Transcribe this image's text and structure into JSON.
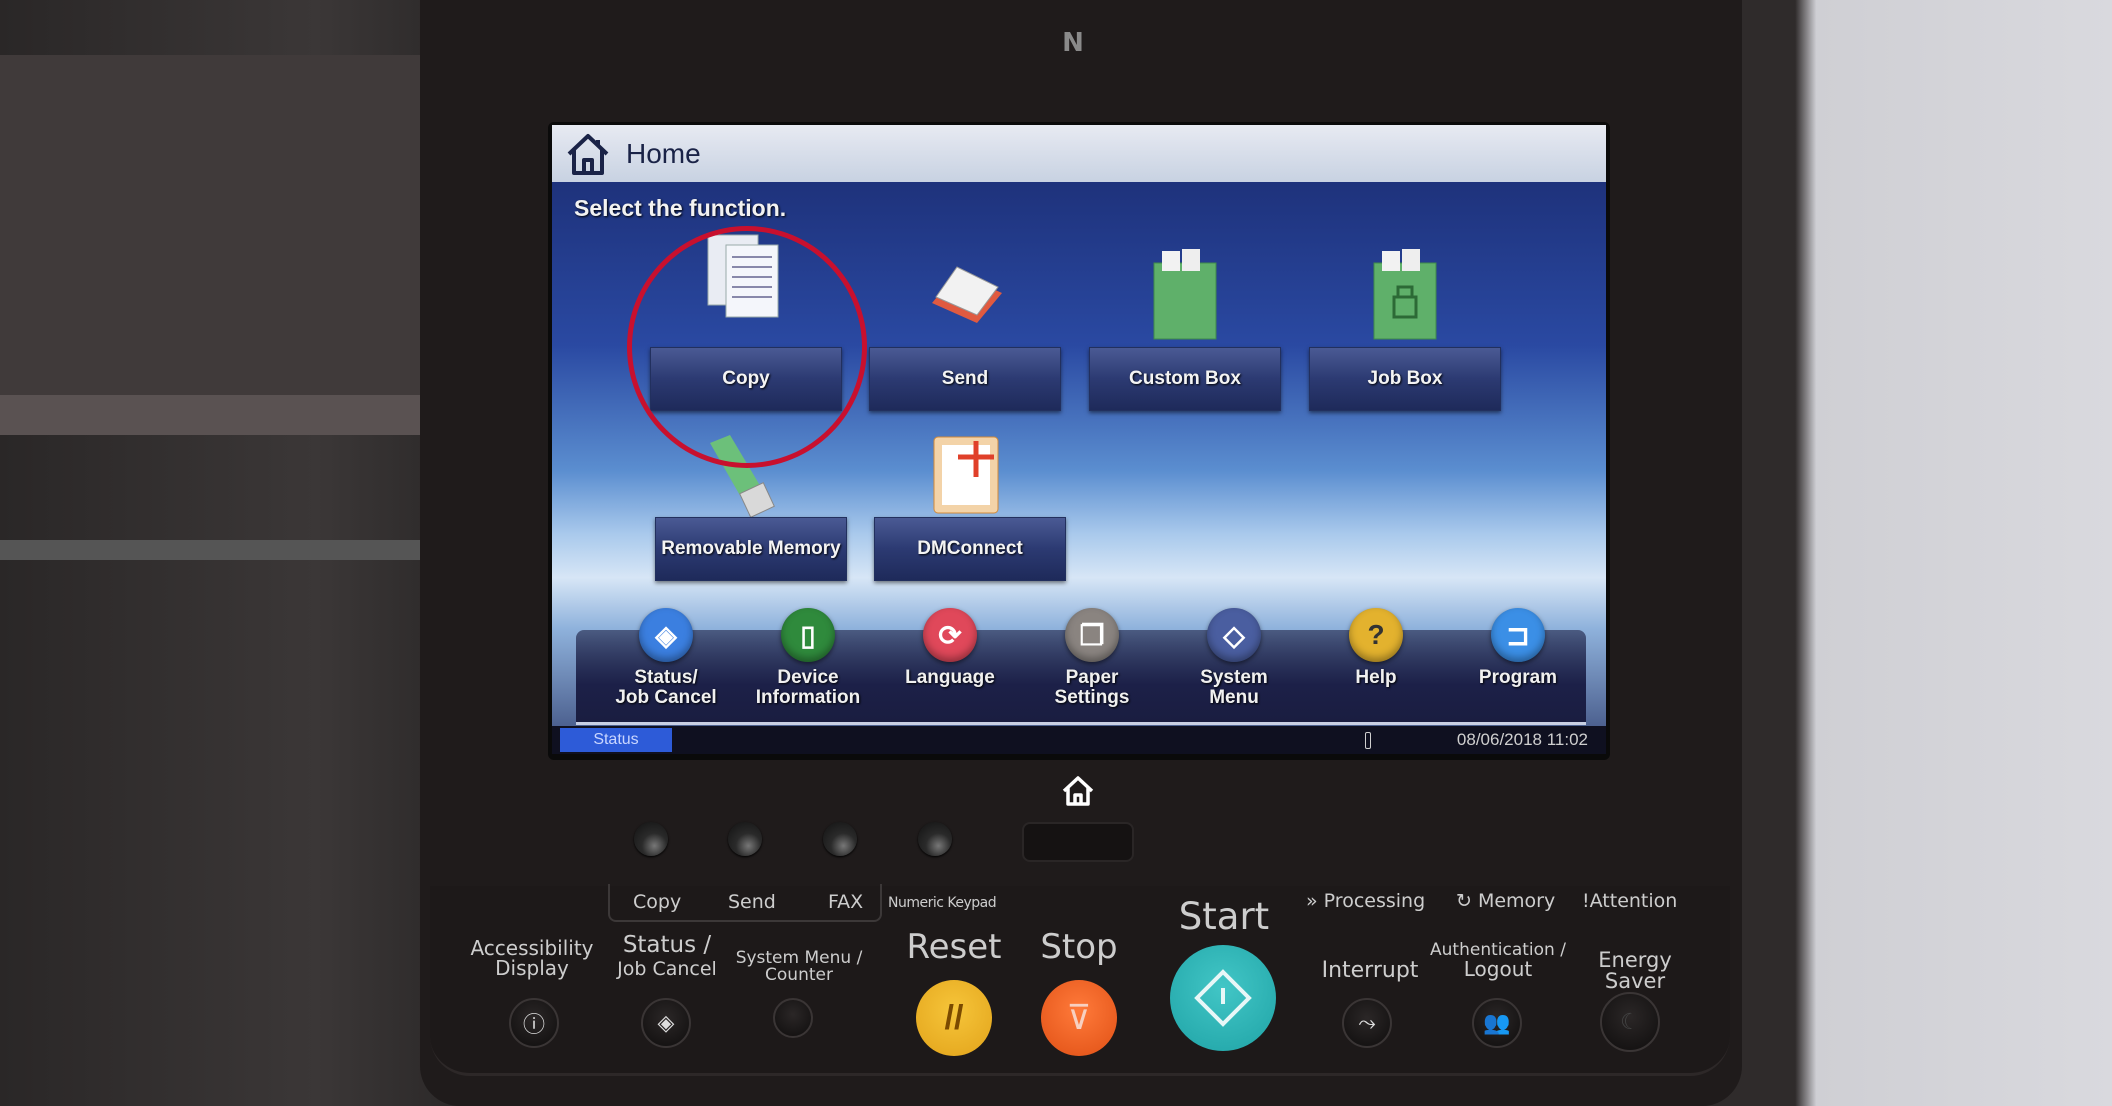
{
  "screen": {
    "title": "Home",
    "prompt": "Select the function.",
    "tiles": [
      {
        "label": "Copy",
        "icon": "copy-documents-icon",
        "highlighted": true
      },
      {
        "label": "Send",
        "icon": "send-tray-icon"
      },
      {
        "label": "Custom Box",
        "icon": "custom-box-icon"
      },
      {
        "label": "Job Box",
        "icon": "job-box-icon"
      },
      {
        "label": "Removable Memory",
        "icon": "usb-drive-icon"
      },
      {
        "label": "DMConnect",
        "icon": "dmconnect-icon"
      }
    ],
    "bottom_bar": [
      {
        "label_line1": "Status/",
        "label_line2": "Job Cancel",
        "icon": "status-diamond-icon",
        "color": "#3b7fe0",
        "glyph": "◈"
      },
      {
        "label_line1": "Device",
        "label_line2": "Information",
        "icon": "device-info-icon",
        "color": "#2f8a3c",
        "glyph": "▯"
      },
      {
        "label_line1": "Language",
        "label_line2": "",
        "icon": "language-icon",
        "color": "#e0485a",
        "glyph": "⟳"
      },
      {
        "label_line1": "Paper",
        "label_line2": "Settings",
        "icon": "paper-settings-icon",
        "color": "#8a8480",
        "glyph": "❐"
      },
      {
        "label_line1": "System",
        "label_line2": "Menu",
        "icon": "system-menu-icon",
        "color": "#4a5ea0",
        "glyph": "◇"
      },
      {
        "label_line1": "Help",
        "label_line2": "",
        "icon": "help-icon",
        "color": "#e3b22e",
        "glyph": "?"
      },
      {
        "label_line1": "Program",
        "label_line2": "",
        "icon": "program-icon",
        "color": "#3b8fe6",
        "glyph": "⊐"
      }
    ],
    "status_button": "Status",
    "datetime": "08/06/2018  11:02"
  },
  "panel": {
    "mode_labels": [
      "Copy",
      "Send",
      "FAX"
    ],
    "numeric_keypad": "Numeric Keypad",
    "accessibility": [
      "Accessibility",
      "Display"
    ],
    "status_job_cancel": [
      "Status /",
      "Job Cancel"
    ],
    "system_menu_counter": [
      "System Menu /",
      "Counter"
    ],
    "reset": "Reset",
    "stop": "Stop",
    "start": "Start",
    "indicators": [
      "Processing",
      "Memory",
      "Attention"
    ],
    "interrupt": "Interrupt",
    "auth_logout": [
      "Authentication /",
      "Logout"
    ],
    "energy_saver": "Energy Saver",
    "colors": {
      "reset": "#f0b52a",
      "stop": "#f0662a",
      "start": "#2fb6b8",
      "highlight_circle": "#c8102e"
    }
  }
}
